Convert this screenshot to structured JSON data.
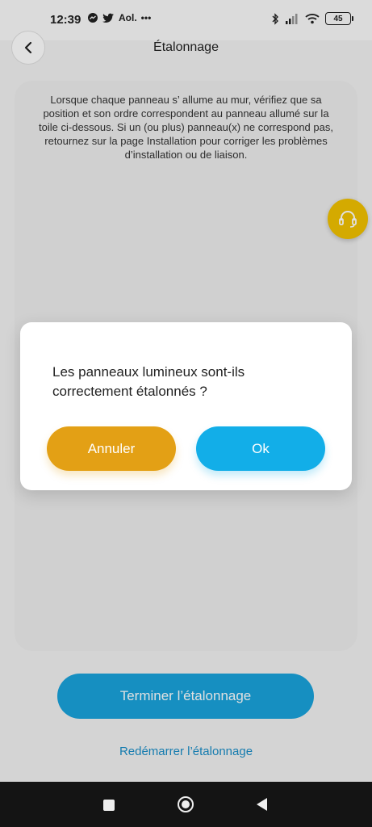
{
  "status_bar": {
    "time": "12:39",
    "notifications": [
      "messenger-icon",
      "twitter-icon"
    ],
    "carrier_text": "Aol.",
    "more": "•••",
    "battery": "45"
  },
  "header": {
    "title": "Étalonnage",
    "back_icon": "chevron-left-icon"
  },
  "instructions": "Lorsque chaque panneau s’ allume au mur, vérifiez que sa position et son ordre correspondent au panneau allumé sur la toile ci-dessous. Si un (ou plus) panneau(x) ne correspond pas, retournez sur la page Installation pour corriger les problèmes d’installation ou de liaison.",
  "support": {
    "icon": "headset-icon"
  },
  "actions": {
    "finish_label": "Terminer l’étalonnage",
    "restart_label": "Redémarrer l’étalonnage"
  },
  "dialog": {
    "message": "Les panneaux lumineux sont-ils correctement étalonnés ?",
    "cancel_label": "Annuler",
    "ok_label": "Ok"
  },
  "colors": {
    "accent_blue": "#12aee8",
    "accent_orange": "#e3a015",
    "support_yellow": "#f2c200",
    "link_blue": "#1a8ec8"
  }
}
